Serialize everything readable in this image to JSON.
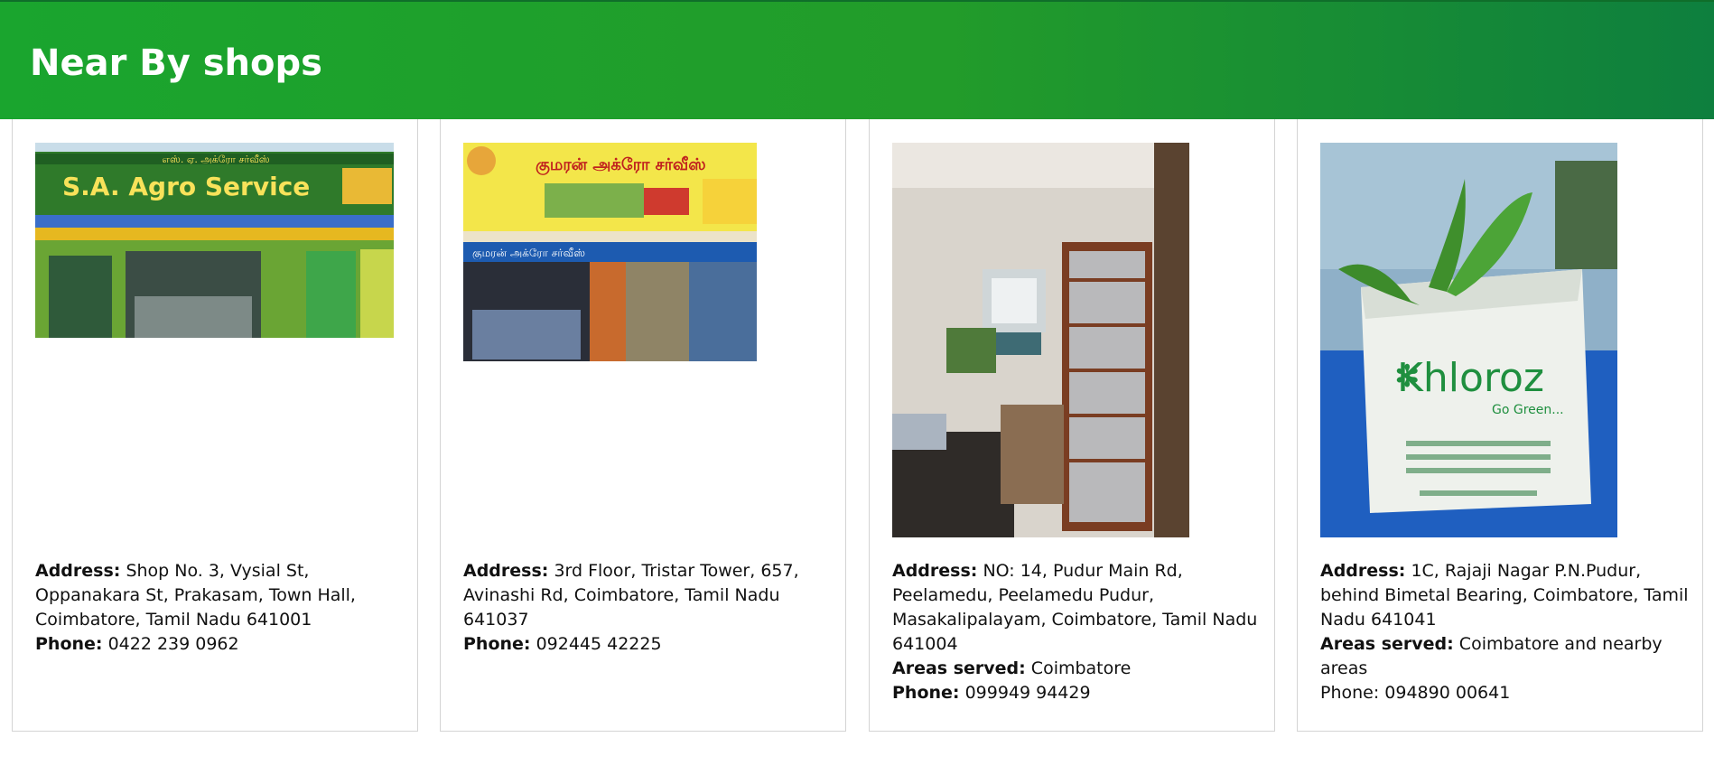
{
  "header": {
    "title": "Near By shops"
  },
  "colors": {
    "header_start": "#1aa52e",
    "header_end": "#0e7f3e",
    "card_border": "#d4d4d4"
  },
  "shops": [
    {
      "image_alt": "S.A. Agro Service storefront",
      "sign_text": "S.A. Agro Service",
      "address_label": "Address:",
      "address": "Shop No. 3, Vysial St, Oppanakara St, Prakasam, Town Hall, Coimbatore, Tamil Nadu 641001",
      "phone_label": "Phone:",
      "phone": "0422 239 0962"
    },
    {
      "image_alt": "Kumaran Agro Service storefront",
      "sign_text": "குமரன் அக்ரோ சர்வீஸ்",
      "address_label": "Address:",
      "address": "3rd Floor, Tristar Tower, 657, Avinashi Rd, Coimbatore, Tamil Nadu 641037",
      "phone_label": "Phone:",
      "phone": "092445 42225"
    },
    {
      "image_alt": "Shop interior with shelves of seed packets",
      "address_label": "Address:",
      "address": "NO: 14, Pudur Main Rd, Peelamedu, Peelamedu Pudur, Masakalipalayam, Coimbatore, Tamil Nadu 641004",
      "areas_label": "Areas served:",
      "areas": "Coimbatore",
      "phone_label": "Phone:",
      "phone": "099949 94429"
    },
    {
      "image_alt": "Khloroz grow bag with plant",
      "bag_brand": "Khloroz",
      "bag_tagline": "Go Green...",
      "address_label": "Address:",
      "address": "1C, Rajaji Nagar P.N.Pudur, behind Bimetal Bearing, Coimbatore, Tamil Nadu 641041",
      "areas_label": "Areas served:",
      "areas": "Coimbatore and nearby areas",
      "phone_text": "Phone: 094890 00641"
    }
  ]
}
